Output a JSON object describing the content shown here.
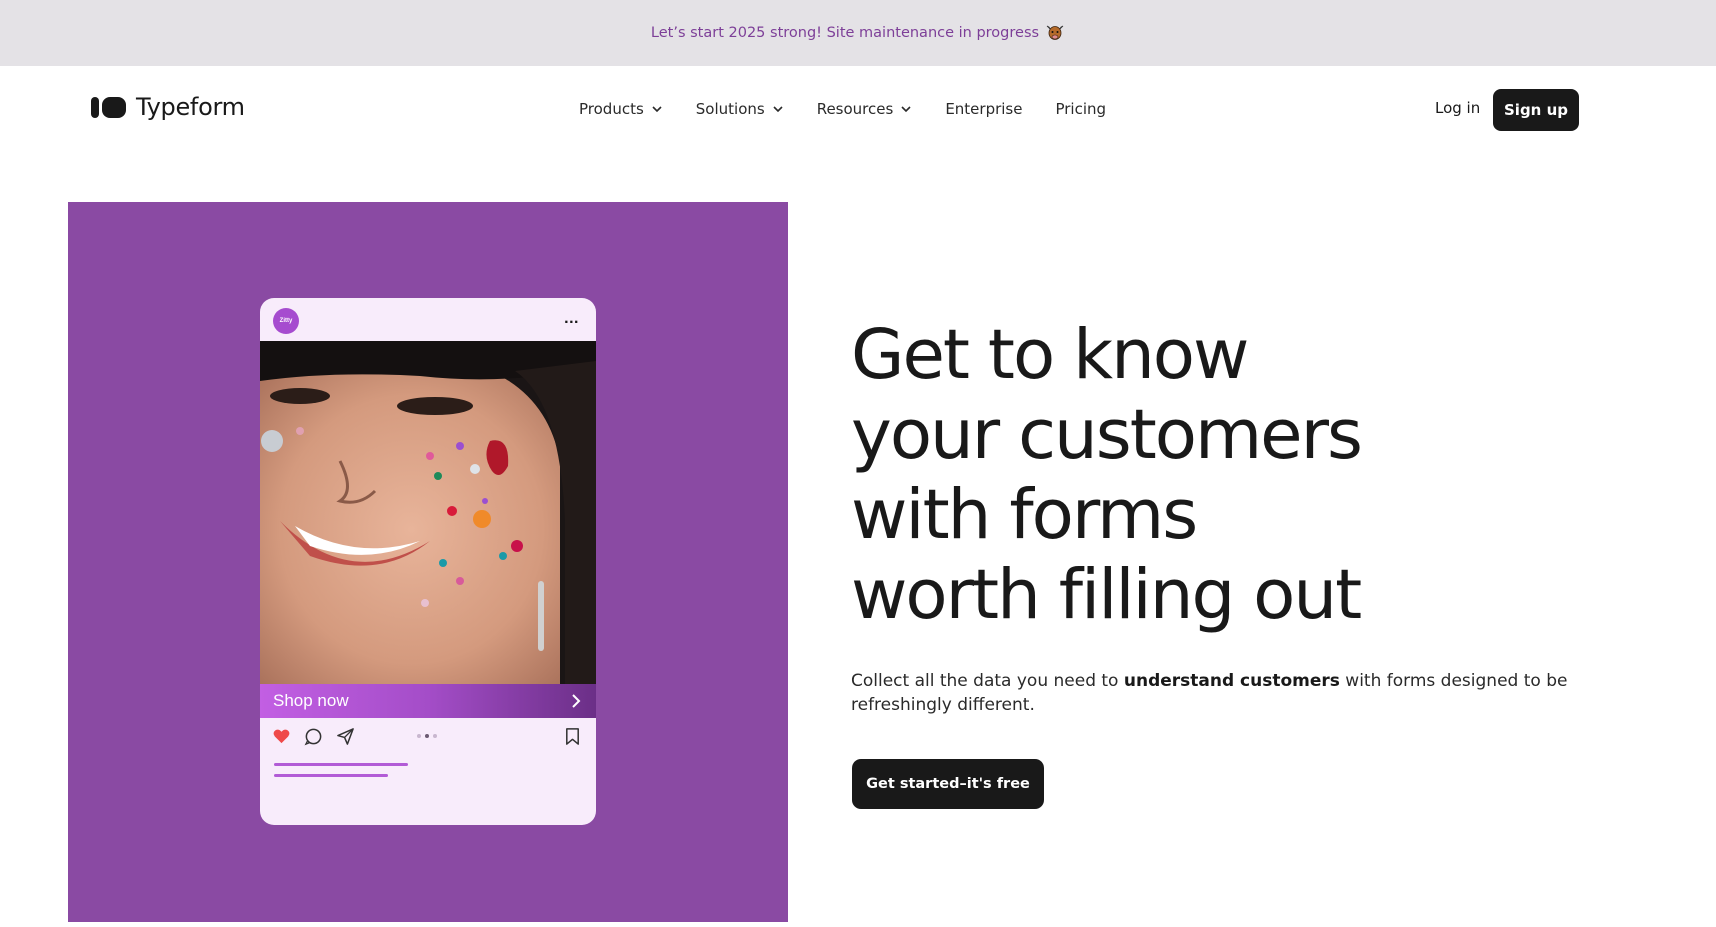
{
  "banner": {
    "text": "Let’s start 2025 strong! Site maintenance in progress",
    "emoji_icon": "bull-face-icon"
  },
  "nav": {
    "logo_text": "Typeform",
    "items": [
      {
        "label": "Products",
        "has_dropdown": true
      },
      {
        "label": "Solutions",
        "has_dropdown": true
      },
      {
        "label": "Resources",
        "has_dropdown": true
      },
      {
        "label": "Enterprise",
        "has_dropdown": false
      },
      {
        "label": "Pricing",
        "has_dropdown": false
      }
    ],
    "login_label": "Log in",
    "signup_label": "Sign up"
  },
  "hero": {
    "panel_color": "#8a4aa3",
    "card": {
      "avatar_text": "Zitty",
      "menu_text": "...",
      "cta_label": "Shop now",
      "carousel": {
        "count": 3,
        "active": 1
      }
    },
    "headline_lines": [
      "Get to know",
      "your customers",
      "with forms",
      "worth filling out"
    ],
    "subtext": {
      "before": "Collect all the data you need to ",
      "bold": "understand customers",
      "after": " with forms designed to be refreshingly different."
    },
    "cta_label": "Get started–it's free"
  },
  "colors": {
    "brand_dark": "#191919",
    "accent_purple": "#8a4aa3",
    "banner_bg": "#e4e2e6",
    "banner_text": "#7d3f98"
  }
}
